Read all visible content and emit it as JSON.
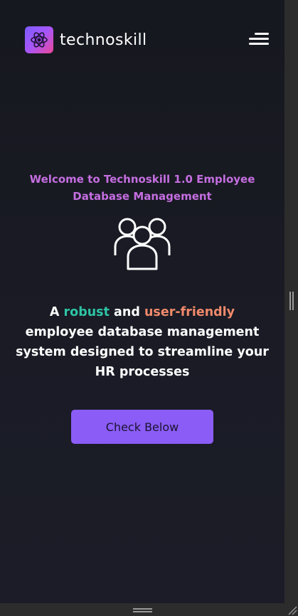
{
  "header": {
    "brand_name": "technoskill",
    "logo_icon": "atom-icon",
    "menu_icon": "hamburger-menu-icon"
  },
  "hero": {
    "subtitle": "Welcome to Technoskill 1.0 Employee Database Management",
    "icon": "users-group-icon",
    "heading": {
      "part1": "A ",
      "highlight1": "robust",
      "part2": " and ",
      "highlight2": "user-friendly",
      "part3": " employee database management system designed to streamline your HR processes"
    },
    "cta_label": "Check Below"
  },
  "colors": {
    "background": "#16181f",
    "subtitle": "#c46ee0",
    "highlight1": "#2ec4a6",
    "highlight2": "#f08a6b",
    "button": "#8b5cf6"
  }
}
